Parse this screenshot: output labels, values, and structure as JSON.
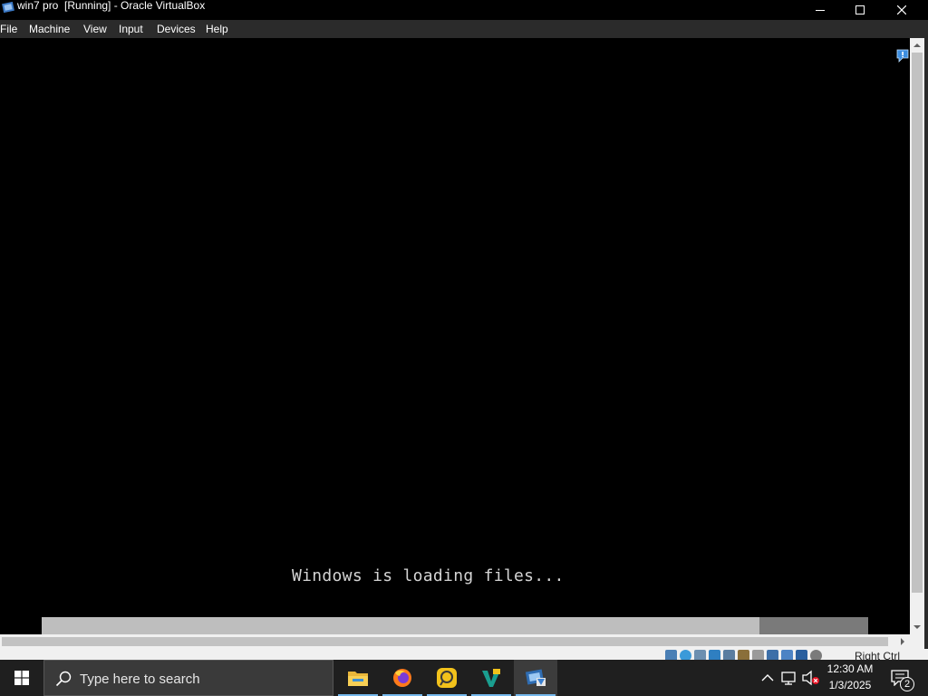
{
  "window": {
    "title": "win7 pro  [Running] - Oracle VirtualBox",
    "icon": "virtualbox-icon",
    "controls": [
      "minimize-icon",
      "maximize-icon",
      "close-icon"
    ]
  },
  "menu": {
    "items": [
      {
        "label": "File"
      },
      {
        "label": "Machine"
      },
      {
        "label": "View"
      },
      {
        "label": "Input"
      },
      {
        "label": "Devices"
      },
      {
        "label": "Help"
      }
    ]
  },
  "vm_screen": {
    "message": "Windows is loading files...",
    "progress_fraction": 0.868,
    "notification_icon": "info-notification-icon"
  },
  "statusbar": {
    "icons": [
      "hard-disk-icon",
      "optical-drive-icon",
      "audio-icon",
      "network-icon",
      "usb-icon",
      "shared-folders-icon",
      "display-icon",
      "video-capture-icon",
      "virtualization-icon",
      "mouse-integration-icon",
      "keyboard-icon"
    ],
    "host_key": "Right Ctrl"
  },
  "taskbar": {
    "search_placeholder": "Type here to search",
    "apps": [
      {
        "name": "file-explorer-icon",
        "active": false
      },
      {
        "name": "firefox-icon",
        "active": false
      },
      {
        "name": "app-icon",
        "active": false
      },
      {
        "name": "virtualbox-manager-icon",
        "active": false
      },
      {
        "name": "virtualbox-vm-icon",
        "active": true
      }
    ],
    "clock": {
      "time": "12:30 AM",
      "date": "1/3/2025"
    },
    "notifications_count": "2"
  },
  "colors": {
    "accent": "#76b9ed",
    "vm_background": "#000000",
    "progress_fill": "#bebebe",
    "progress_track": "#7a7a7a"
  }
}
